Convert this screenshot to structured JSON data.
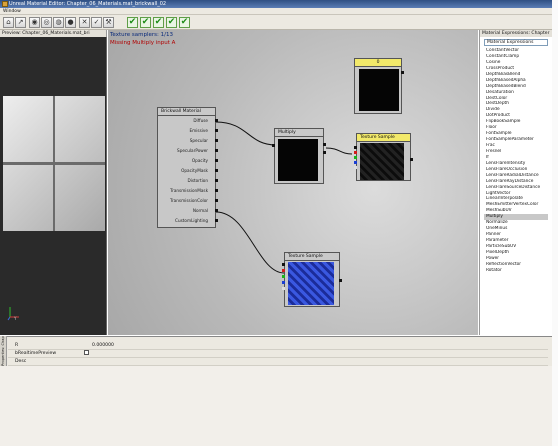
{
  "window": {
    "title": "Unreal Material Editor: Chapter_06_Materials.mat_brickwall_02",
    "menu": "Window"
  },
  "preview": {
    "header": "Preview: Chapter_06_Materials.mat_bri",
    "axis_y": "Y"
  },
  "canvas": {
    "info_line1": "Texture samplers: 1/13",
    "info_line2": "Missing Multiply input A"
  },
  "material_node": {
    "title": "Brickwall Material",
    "inputs": [
      "Diffuse",
      "Emissive",
      "Specular",
      "SpecularPower",
      "Opacity",
      "OpacityMask",
      "Distortion",
      "TransmissionMask",
      "TransmissionColor",
      "Normal",
      "CustomLighting"
    ]
  },
  "multiply_node": {
    "title": "Multiply"
  },
  "top_node": {
    "title": "0"
  },
  "texture_node_1": {
    "title": "Texture Sample"
  },
  "texture_node_2": {
    "title": "Texture Sample"
  },
  "expressions": {
    "header": "Material Expressions: Chapter",
    "dropdown": "Material Expressions",
    "selected": "Multiply",
    "items": [
      "ConstantVector",
      "ConstantClamp",
      "Cosine",
      "CrossProduct",
      "DepthBiasBlend",
      "DepthBiasedAlpha",
      "DepthBiasedBlend",
      "Desaturation",
      "DestColor",
      "DestDepth",
      "Divide",
      "DotProduct",
      "FlipBookSample",
      "Floor",
      "FontSample",
      "FontSampleParameter",
      "Frac",
      "Fresnel",
      "If",
      "LensFlareIntensity",
      "LensFlareOcclusion",
      "LensFlareRadialDistance",
      "LensFlareRayDistance",
      "LensFlareSourceDistance",
      "LightVector",
      "LinearInterpolate",
      "MeshEmitterVertexColor",
      "MeshSubUV",
      "Multiply",
      "Normalize",
      "OneMinus",
      "Panner",
      "Parameter",
      "ParticleSubUV",
      "PixelDepth",
      "Power",
      "ReflectionVector",
      "Rotator"
    ]
  },
  "properties": {
    "side_label": "Properties: Chapter_06_Materials.m",
    "rows": [
      {
        "key": "R",
        "value": "0.000000"
      },
      {
        "key": "bRealtimePreview",
        "value": ""
      },
      {
        "key": "Desc",
        "value": ""
      }
    ]
  },
  "colors": {
    "title_bar": "#3a5a90",
    "error_text": "#b00000",
    "info_text": "#0a2a7a",
    "node_header_active": "#f2e96a"
  }
}
